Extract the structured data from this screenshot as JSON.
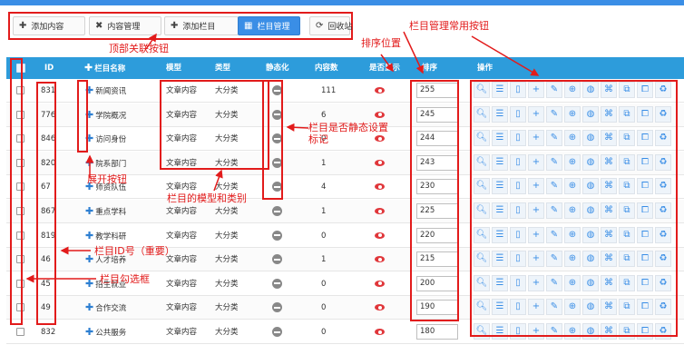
{
  "toolbar": {
    "buttons": [
      {
        "label": "添加内容",
        "icon": "plus-icon"
      },
      {
        "label": "内容管理",
        "icon": "wrench-icon"
      },
      {
        "label": "添加栏目",
        "icon": "plus-icon"
      },
      {
        "label": "栏目管理",
        "icon": "list-icon",
        "active": true
      },
      {
        "label": "回收站",
        "icon": "refresh-icon"
      }
    ]
  },
  "table": {
    "headers": [
      "ID",
      "栏目名称",
      "模型",
      "类型",
      "静态化",
      "内容数",
      "是否显示",
      "排序",
      "操作"
    ],
    "rows": [
      {
        "id": "831",
        "name": "新闻资讯",
        "model": "文章内容",
        "type": "大分类",
        "count": "111",
        "sort": "255"
      },
      {
        "id": "776",
        "name": "学院概况",
        "model": "文章内容",
        "type": "大分类",
        "count": "6",
        "sort": "245"
      },
      {
        "id": "846",
        "name": "访问身份",
        "model": "文章内容",
        "type": "大分类",
        "count": "0",
        "sort": "244"
      },
      {
        "id": "820",
        "name": "院系部门",
        "model": "文章内容",
        "type": "大分类",
        "count": "1",
        "sort": "243"
      },
      {
        "id": "67",
        "name": "师资队伍",
        "model": "文章内容",
        "type": "大分类",
        "count": "4",
        "sort": "230"
      },
      {
        "id": "867",
        "name": "重点学科",
        "model": "文章内容",
        "type": "大分类",
        "count": "1",
        "sort": "225"
      },
      {
        "id": "819",
        "name": "教学科研",
        "model": "文章内容",
        "type": "大分类",
        "count": "0",
        "sort": "220"
      },
      {
        "id": "46",
        "name": "人才培养",
        "model": "文章内容",
        "type": "大分类",
        "count": "1",
        "sort": "215"
      },
      {
        "id": "45",
        "name": "招生就业",
        "model": "文章内容",
        "type": "大分类",
        "count": "0",
        "sort": "200"
      },
      {
        "id": "49",
        "name": "合作交流",
        "model": "文章内容",
        "type": "大分类",
        "count": "0",
        "sort": "190"
      },
      {
        "id": "832",
        "name": "公共服务",
        "model": "文章内容",
        "type": "大分类",
        "count": "0",
        "sort": "180"
      }
    ],
    "op_icons": [
      "search-icon",
      "list-icon",
      "mobile-icon",
      "add-icon",
      "edit-icon",
      "zoom-icon",
      "globe-icon",
      "merge-icon",
      "copy-icon",
      "external-edit-icon",
      "recycle-icon"
    ]
  },
  "annotations": {
    "top_buttons": "顶部关联按钮",
    "sort_position": "排序位置",
    "common_buttons": "栏目管理常用按钮",
    "static_flag": "栏目是否静态设置\n标记",
    "expand_button": "展开按钮",
    "model_type": "栏目的模型和类别",
    "column_id": "栏目ID号（重要）",
    "column_checkbox": "栏目勾选框"
  },
  "colors": {
    "header": "#2d9cdb",
    "accent": "#3a8ee6",
    "annotation": "#e21b1b"
  }
}
